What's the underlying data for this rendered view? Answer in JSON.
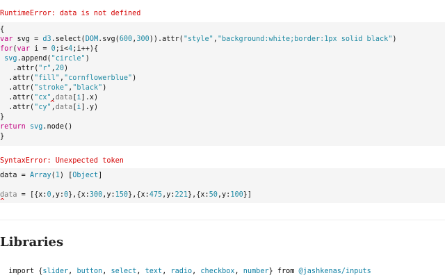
{
  "errors": {
    "runtime": "RuntimeError: data is not defined",
    "syntax": "SyntaxError: Unexpected token"
  },
  "cell1": {
    "l1": "{",
    "l2": {
      "kw1": "var",
      "a": " svg = ",
      "fn1": "d3",
      "b": ".select(",
      "fn2": "DOM",
      "c": ".svg(",
      "n1": "600",
      "d": ",",
      "n2": "300",
      "e": ")).attr(",
      "s1": "\"style\"",
      "f": ",",
      "s2": "\"background:white;border:1px solid black\"",
      "g": ")"
    },
    "l3": {
      "kw1": "for",
      "a": "(",
      "kw2": "var",
      "b": " i = ",
      "n1": "0",
      "c": ";i<",
      "n2": "4",
      "d": ";i++){"
    },
    "l4": {
      "sp": " ",
      "fn": "svg",
      "a": ".append(",
      "s": "\"circle\"",
      "b": ")"
    },
    "l5": {
      "a": "   .attr(",
      "s": "\"r\"",
      "b": ",",
      "n": "20",
      "c": ")"
    },
    "l6": {
      "a": "  .attr(",
      "s1": "\"fill\"",
      "b": ",",
      "s2": "\"cornflowerblue\"",
      "c": ")"
    },
    "l7": {
      "a": "  .attr(",
      "s1": "\"stroke\"",
      "b": ",",
      "s2": "\"black\"",
      "c": ")"
    },
    "l8": {
      "a": "  .attr(",
      "s": "\"cx\"",
      "b": ",",
      "d": "data",
      "c": "[",
      "i": "i",
      "e": "].x)"
    },
    "l9": {
      "a": "  .attr(",
      "s": "\"cy\"",
      "b": ",",
      "d": "data",
      "c": "[",
      "i": "i",
      "e": "].y)"
    },
    "l10": "}",
    "l11": {
      "kw": "return",
      "a": " ",
      "fn": "svg",
      "b": ".node()"
    },
    "l12": "}"
  },
  "cell2": {
    "l1": {
      "a": "data = ",
      "fn": "Array",
      "b": "(",
      "n": "1",
      "c": ") [",
      "o": "Object",
      "d": "]"
    },
    "l2": {
      "d": "data",
      "a": " = [{x:",
      "n1": "0",
      "b": ",y:",
      "n2": "0",
      "c": "},{x:",
      "n3": "300",
      "e": ",y:",
      "n4": "150",
      "f": "},{x:",
      "n5": "475",
      "g": ",y:",
      "n6": "221",
      "h": "},{x:",
      "n7": "50",
      "i": ",y:",
      "n8": "100",
      "j": "}]"
    }
  },
  "section_title": "Libraries",
  "imports": {
    "a": "import {",
    "items": [
      "slider",
      "button",
      "select",
      "text",
      "radio",
      "checkbox",
      "number"
    ],
    "sep": ", ",
    "b": "} from ",
    "pkg": "@jashkenas/inputs"
  },
  "caret": "^",
  "colors": {
    "error": "#d40000",
    "keyword": "#c20080",
    "function": "#0e7fa3",
    "string": "#1f8aa3",
    "cell_bg": "#f5f5f5"
  }
}
